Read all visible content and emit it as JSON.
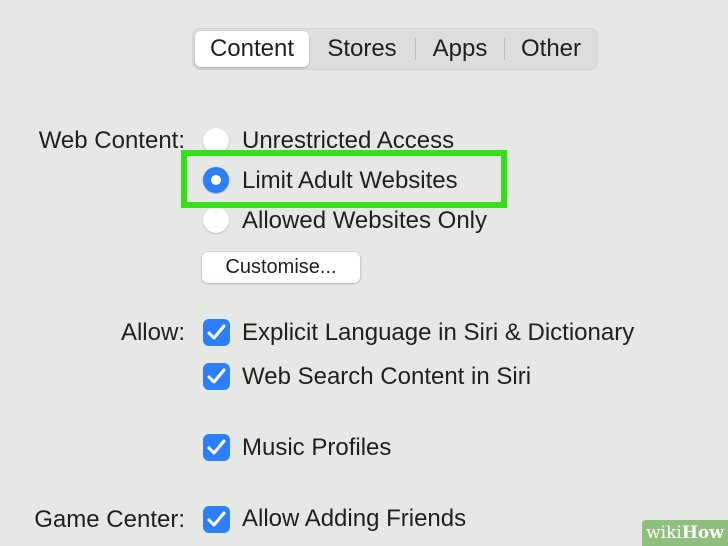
{
  "tabs": [
    {
      "label": "Content",
      "active": true
    },
    {
      "label": "Stores",
      "active": false
    },
    {
      "label": "Apps",
      "active": false
    },
    {
      "label": "Other",
      "active": false
    }
  ],
  "web_content": {
    "label": "Web Content:",
    "options": [
      {
        "label": "Unrestricted Access",
        "selected": false
      },
      {
        "label": "Limit Adult Websites",
        "selected": true
      },
      {
        "label": "Allowed Websites Only",
        "selected": false
      }
    ],
    "customise_button": "Customise..."
  },
  "allow": {
    "label": "Allow:",
    "items": [
      {
        "label": "Explicit Language in Siri & Dictionary",
        "checked": true
      },
      {
        "label": "Web Search Content in Siri",
        "checked": true
      },
      {
        "label": "Music Profiles",
        "checked": true
      }
    ]
  },
  "game_center": {
    "label": "Game Center:",
    "items": [
      {
        "label": "Allow Adding Friends",
        "checked": true
      }
    ]
  },
  "watermark": {
    "prefix": "wiki",
    "suffix": "How"
  },
  "colors": {
    "accent": "#2d7ff9",
    "highlight": "#35e01a",
    "background": "#e6e8e6"
  }
}
